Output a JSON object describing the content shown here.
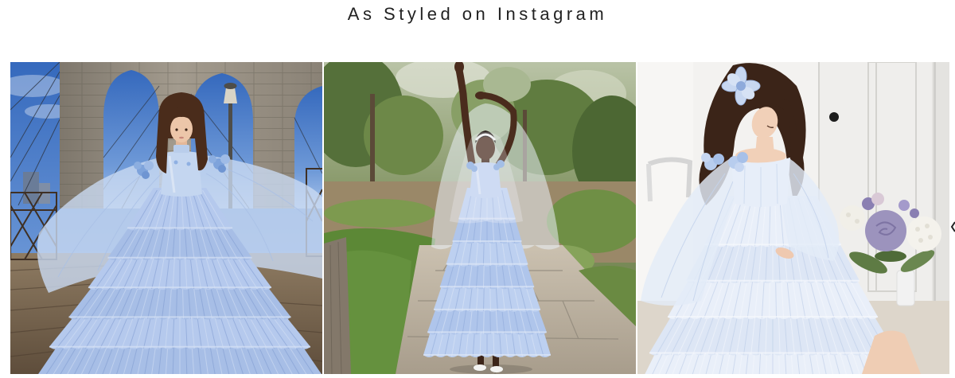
{
  "heading": "As Styled on Instagram",
  "carousel": {
    "arrow_icon": "chevron-left-icon"
  },
  "colors": {
    "heading_text": "#222222",
    "page_background": "#ffffff",
    "dress_blue": "#b5c9ed"
  }
}
